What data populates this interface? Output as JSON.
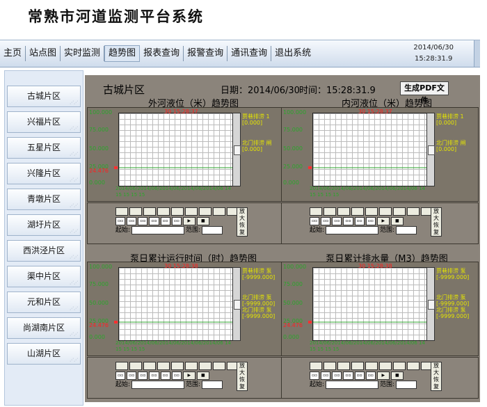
{
  "app_title": "常熟市河道监测平台系统",
  "nav": {
    "items": [
      "主页",
      "站点图",
      "实时监测",
      "趋势图",
      "报表查询",
      "报警查询",
      "通讯查询",
      "退出系统"
    ],
    "active": "趋势图",
    "date": "2014/06/30",
    "time": "15:28:31.9"
  },
  "sidebar": {
    "items": [
      "古城片区",
      "兴福片区",
      "五星片区",
      "兴隆片区",
      "青墩片区",
      "湖圩片区",
      "西洪泾片区",
      "渠中片区",
      "元和片区",
      "尚湖南片区",
      "山湖片区"
    ]
  },
  "main": {
    "region": "古城片区",
    "date_label": "日期：2014/06/30",
    "time_label": "时间：15:28:31.9",
    "pdf_button": "生成PDF文件"
  },
  "charts": [
    {
      "title": "外河液位（米）趋势图",
      "y_ticks": [
        "100.000",
        "75.000",
        "50.000",
        "25.000",
        "0.000"
      ],
      "current_value": "24.476",
      "timestamp": "30 15:28:37",
      "legend": [
        "贾巷排涝 1",
        "[0.000]",
        "北门排涝 闸",
        "[0.000]"
      ],
      "x_labels": "2014/06/2014/06/2014/06/2014/06/2014/06 14 15 15 15 15",
      "start_label": "起始:",
      "range_label": "范围:",
      "zoom_label": "放大恢复",
      "colors": {
        "line": "#2ca52c",
        "alarm": "#ff2020",
        "legend": "#e6e600"
      }
    },
    {
      "title": "内河液位（米）趋势图",
      "y_ticks": [
        "100.000",
        "75.000",
        "50.000",
        "25.000",
        "0.000"
      ],
      "current_value": "",
      "timestamp": "30 15:28:37",
      "legend": [
        "贾巷排涝 1",
        "[0.000]",
        "北门排涝 闸",
        "[0.000]"
      ],
      "x_labels": "2014/06/2014/06/2014/06/2014/06/2014/06 14 15 15 15 15",
      "start_label": "起始:",
      "range_label": "范围:",
      "zoom_label": "放大恢复",
      "colors": {
        "line": "#2ca52c",
        "alarm": "#ff2020",
        "legend": "#e6e600"
      }
    },
    {
      "title": "泵日累计运行时间（时）趋势图",
      "y_ticks": [
        "100.000",
        "75.000",
        "50.000",
        "25.000",
        "0.000"
      ],
      "current_value": "24.476",
      "timestamp": "30 15:28:38",
      "legend": [
        "贾巷排涝 泵",
        "[-9999.000]",
        "北门排涝 泵",
        "[-9999.000]",
        "北门排涝 泵",
        "[-9999.000]"
      ],
      "x_labels": "2014/06/2014/06/2014/06/2014/06/2014/06 14 15 15 15 15",
      "start_label": "起始:",
      "range_label": "范围:",
      "zoom_label": "放大恢复",
      "colors": {
        "line": "#2ca52c",
        "alarm": "#ff2020",
        "legend": "#e6e600"
      }
    },
    {
      "title": "泵日累计排水量（M3）趋势图",
      "y_ticks": [
        "100.000",
        "75.000",
        "50.000",
        "25.000",
        "0.000"
      ],
      "current_value": "24.476",
      "timestamp": "30 15:28:38",
      "legend": [
        "贾巷排涝 泵",
        "[-9999.000]",
        "北门排涝 泵",
        "[-9999.000]",
        "北门排涝 泵",
        "[-9999.000]"
      ],
      "x_labels": "2014/06/2014/06/2014/06/2014/06/2014/06 14 15 15 15 15",
      "start_label": "起始:",
      "range_label": "范围:",
      "zoom_label": "放大恢复",
      "colors": {
        "line": "#2ca52c",
        "alarm": "#ff2020",
        "legend": "#e6e600"
      }
    }
  ]
}
